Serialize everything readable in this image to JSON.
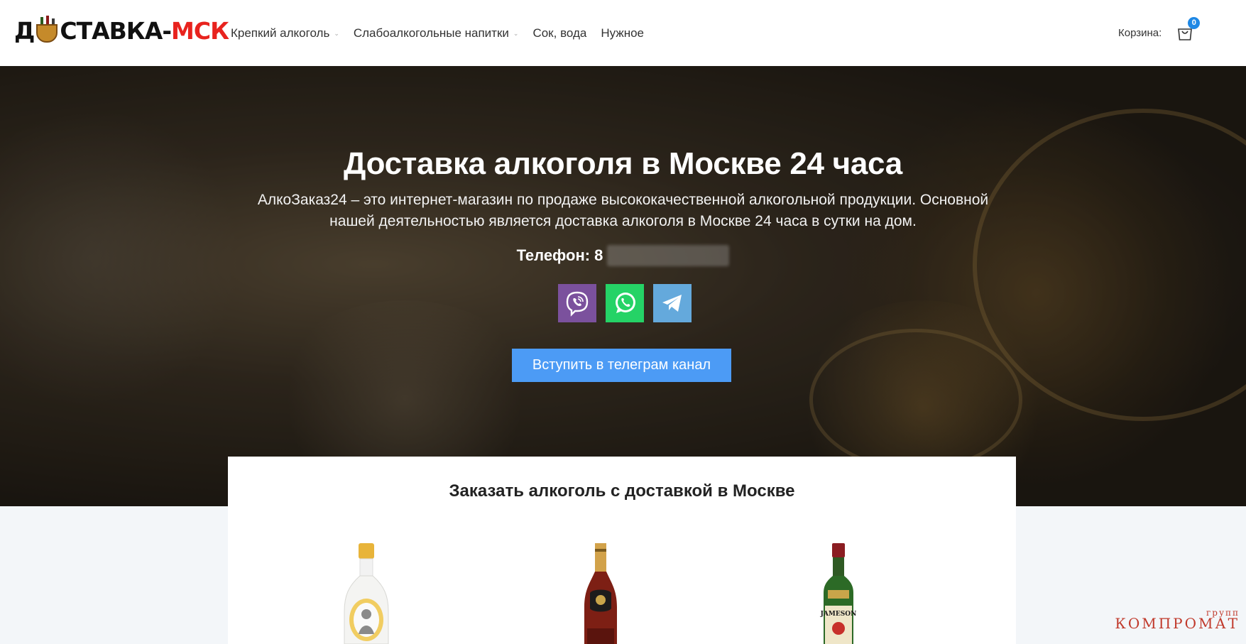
{
  "header": {
    "logo": {
      "part1": "Д",
      "part2": "СТАВКА-",
      "part3": "МСК"
    },
    "nav": [
      {
        "label": "Крепкий алкоголь",
        "has_dropdown": true
      },
      {
        "label": "Слабоалкогольные напитки",
        "has_dropdown": true
      },
      {
        "label": "Сок, вода",
        "has_dropdown": false
      },
      {
        "label": "Нужное",
        "has_dropdown": false
      }
    ],
    "cart": {
      "label": "Корзина:",
      "count": "0",
      "icon": "shopping-bag-icon"
    }
  },
  "hero": {
    "title": "Доставка алкоголя в Москве 24 часа",
    "subtitle": "АлкоЗаказ24 – это интернет-магазин по продаже высококачественной алкогольной продукции. Основной нашей деятельностью является доставка алкоголя в Москве 24 часа в сутки на дом.",
    "phone_label": "Телефон: 8",
    "messengers": [
      {
        "name": "viber",
        "icon": "viber-icon",
        "color": "#7b519d"
      },
      {
        "name": "whatsapp",
        "icon": "whatsapp-icon",
        "color": "#25d366"
      },
      {
        "name": "telegram",
        "icon": "telegram-icon",
        "color": "#64a9dc"
      }
    ],
    "cta_label": "Вступить в телеграм канал",
    "cta_color": "#4c9bf5"
  },
  "catalog": {
    "title": "Заказать алкоголь с доставкой в Москве",
    "products": [
      {
        "icon": "vodka-bottle-image"
      },
      {
        "icon": "cognac-bottle-image"
      },
      {
        "icon": "whiskey-bottle-image",
        "label_text": "JAMESON"
      }
    ]
  },
  "watermark": {
    "top": "групп",
    "main": "КОМПРОМАТ"
  },
  "colors": {
    "brand_red": "#e8231e",
    "accent_blue": "#1e88e5"
  }
}
